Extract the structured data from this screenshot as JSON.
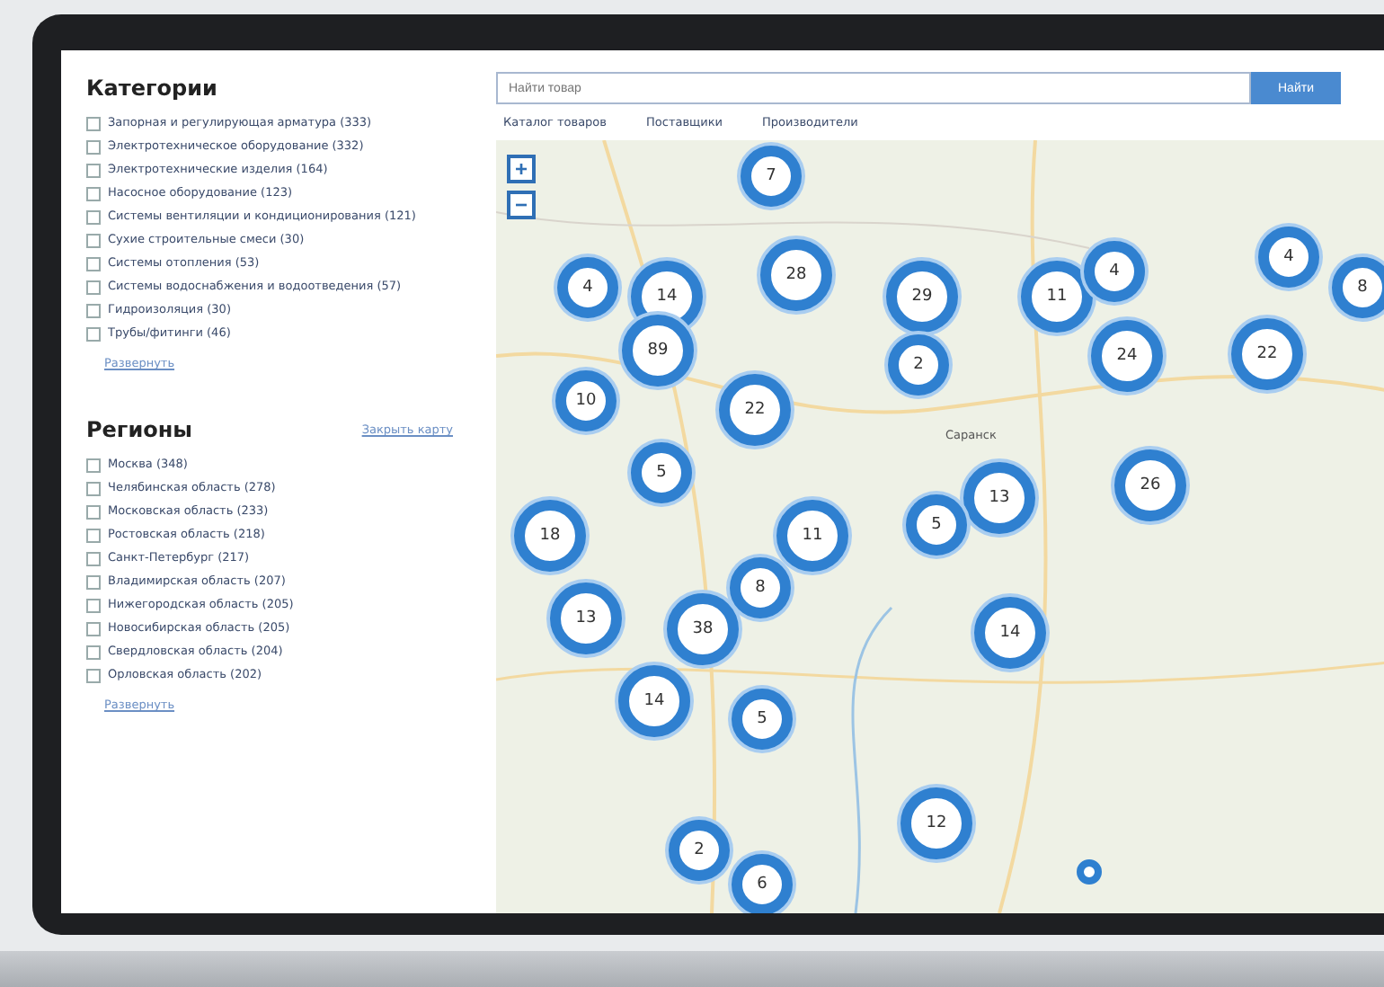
{
  "categories": {
    "title": "Категории",
    "items": [
      {
        "label": "Запорная и регулирующая арматура (333)",
        "checked": false
      },
      {
        "label": "Электротехническое оборудование (332)",
        "checked": false
      },
      {
        "label": "Электротехнические изделия (164)",
        "checked": false
      },
      {
        "label": "Насосное оборудование (123)",
        "checked": false
      },
      {
        "label": "Системы вентиляции и кондиционирования (121)",
        "checked": false
      },
      {
        "label": "Сухие строительные смеси (30)",
        "checked": false
      },
      {
        "label": "Системы отопления (53)",
        "checked": false
      },
      {
        "label": "Системы водоснабжения и водоотведения (57)",
        "checked": false
      },
      {
        "label": "Гидроизоляция (30)",
        "checked": false
      },
      {
        "label": "Трубы/фитинги (46)",
        "checked": false
      }
    ],
    "more": "Развернуть"
  },
  "regions": {
    "title": "Регионы",
    "action": "Закрыть карту",
    "items": [
      {
        "label": "Москва (348)",
        "checked": false
      },
      {
        "label": "Челябинская область (278)",
        "checked": false
      },
      {
        "label": "Московская область (233)",
        "checked": false
      },
      {
        "label": "Ростовская область (218)",
        "checked": false
      },
      {
        "label": "Санкт-Петербург (217)",
        "checked": false
      },
      {
        "label": "Владимирская область (207)",
        "checked": false
      },
      {
        "label": "Нижегородская область (205)",
        "checked": false
      },
      {
        "label": "Новосибирская область (205)",
        "checked": false
      },
      {
        "label": "Свердловская область (204)",
        "checked": false
      },
      {
        "label": "Орловская область (202)",
        "checked": false
      }
    ],
    "more": "Развернуть"
  },
  "search": {
    "placeholder": "Найти товар",
    "button": "Найти"
  },
  "tabs": [
    "Каталог товаров",
    "Поставщики",
    "Производители"
  ],
  "map": {
    "zoom_in": "+",
    "zoom_out": "−",
    "labels": [
      "Саранск"
    ],
    "clusters": [
      "7",
      "4",
      "14",
      "28",
      "29",
      "11",
      "4",
      "4",
      "8",
      "89",
      "2",
      "24",
      "22",
      "10",
      "22",
      "5",
      "13",
      "26",
      "18",
      "11",
      "5",
      "8",
      "13",
      "38",
      "14",
      "14",
      "5",
      "12",
      "2",
      "6"
    ]
  }
}
